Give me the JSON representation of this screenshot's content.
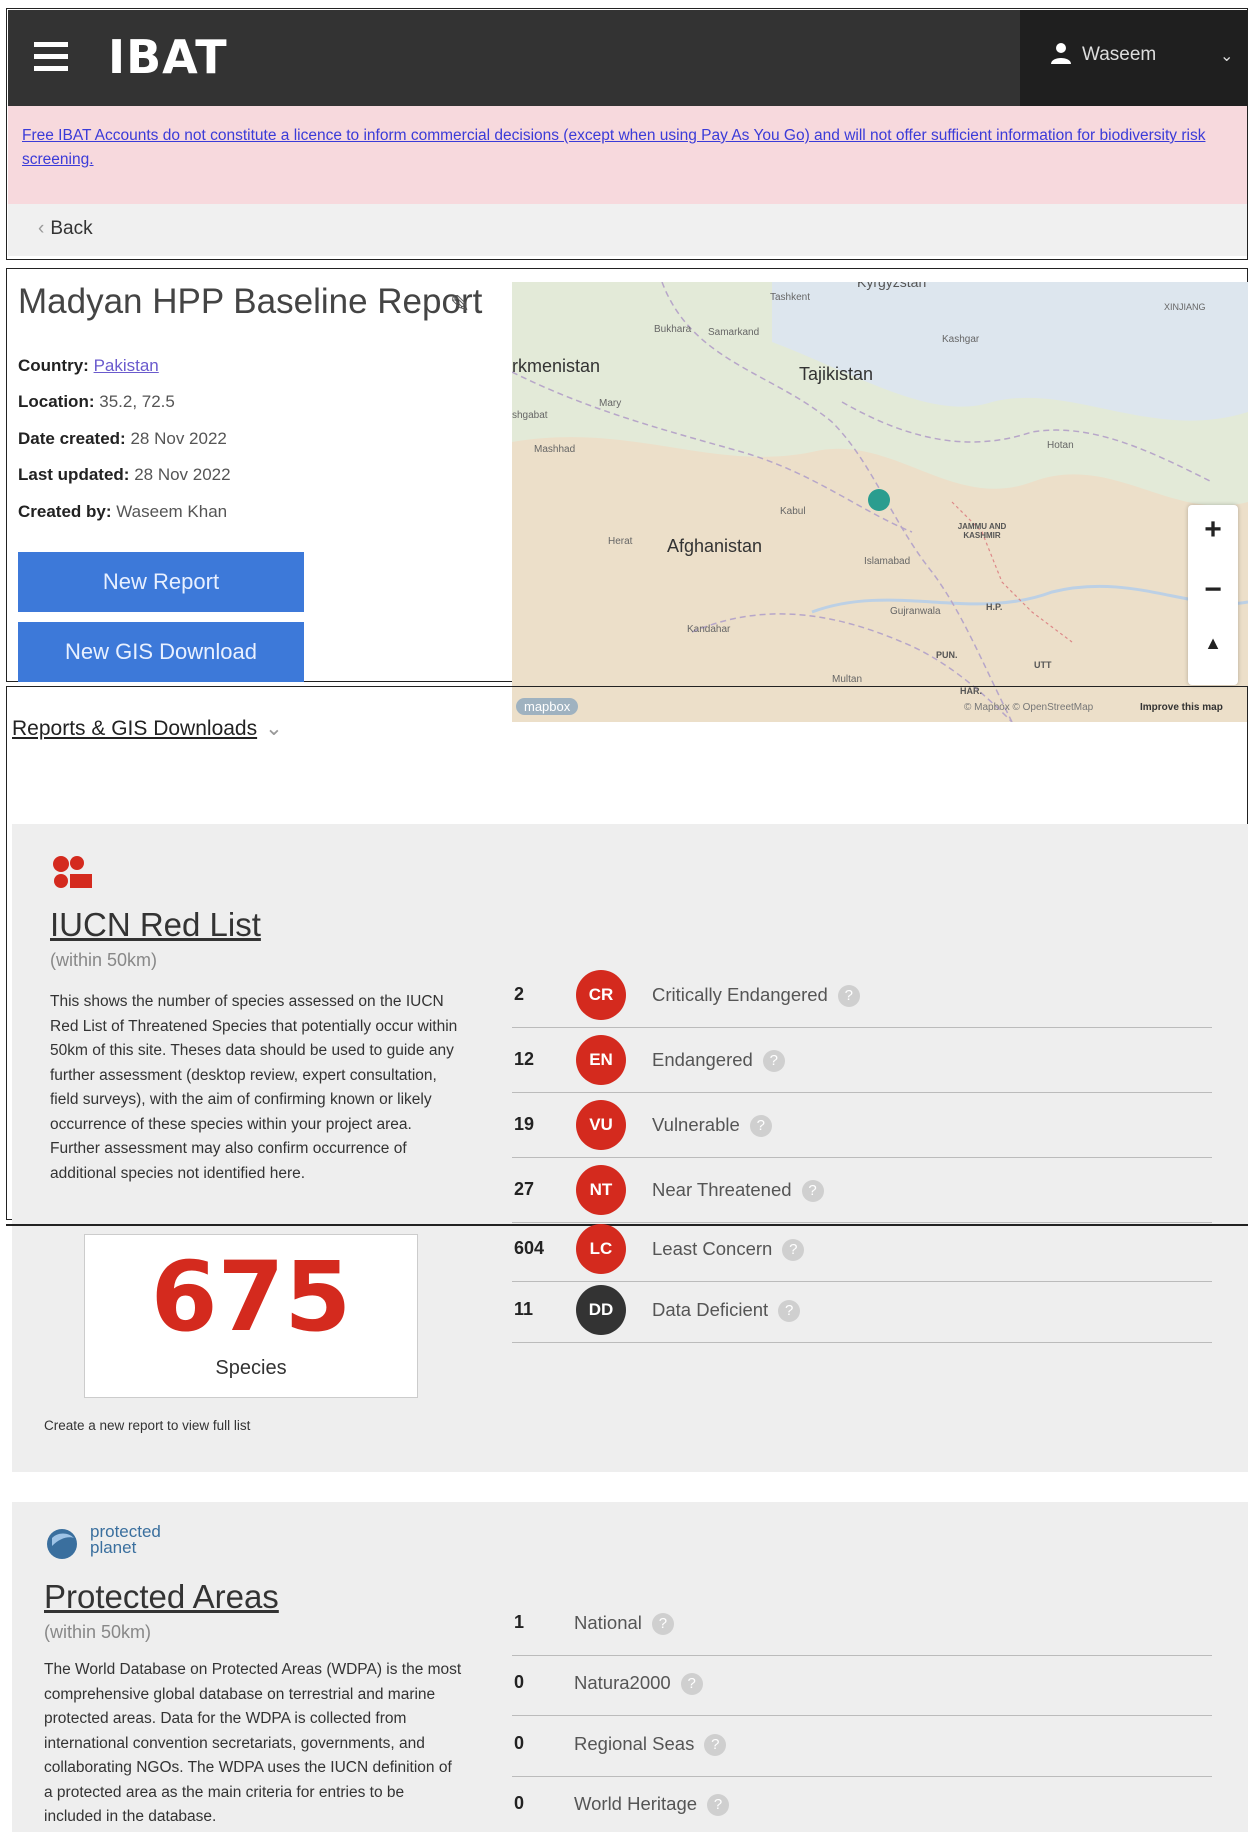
{
  "header": {
    "logo": "IBAT",
    "user_name": "Waseem"
  },
  "notice": {
    "text": "Free IBAT Accounts do not constitute a licence to inform commercial decisions (except when using Pay As You Go) and will not offer sufficient information for biodiversity risk screening."
  },
  "nav": {
    "back_label": "Back"
  },
  "report": {
    "title": "Madyan HPP Baseline Report",
    "country_label": "Country:",
    "country_value": "Pakistan",
    "location_label": "Location:",
    "location_value": "35.2, 72.5",
    "date_created_label": "Date created:",
    "date_created_value": "28 Nov 2022",
    "last_updated_label": "Last updated:",
    "last_updated_value": "28 Nov 2022",
    "created_by_label": "Created by:",
    "created_by_value": "Waseem Khan",
    "new_report_button": "New Report",
    "new_gis_button": "New GIS Download"
  },
  "map": {
    "labels": {
      "kyrgyzstan": "Kyrgyzstan",
      "xinjiang": "XINJIANG",
      "tashkent": "Tashkent",
      "bukhara": "Bukhara",
      "samarkand": "Samarkand",
      "kashgar": "Kashgar",
      "turkmenistan": "rkmenistan",
      "tajikistan": "Tajikistan",
      "ashgabat": "shgabat",
      "mary": "Mary",
      "mashhad": "Mashhad",
      "hotan": "Hotan",
      "kabul": "Kabul",
      "herat": "Herat",
      "afghanistan": "Afghanistan",
      "jammu": "JAMMU AND KASHMIR",
      "islamabad": "Islamabad",
      "gujranwala": "Gujranwala",
      "hp": "H.P.",
      "kandahar": "Kandahar",
      "pun": "PUN.",
      "utt": "UTT",
      "multan": "Multan",
      "har": "HAR."
    },
    "attribution_logo": "mapbox",
    "attribution": "© Mapbox © OpenStreetMap",
    "improve": "Improve this map",
    "marker_color": "#2a9d8f"
  },
  "reports_dropdown": {
    "label": "Reports & GIS Downloads"
  },
  "iucn": {
    "logo_text": "IUCN",
    "title": "IUCN Red List",
    "subtitle": "(within 50km)",
    "description": "This shows the number of species assessed on the IUCN Red List of Threatened Species that potentially occur within 50km of this site. Theses data should be used to guide any further assessment (desktop review, expert consultation, field surveys), with the aim of confirming known or likely occurrence of these species within your project area. Further assessment may also confirm occurrence of additional species not identified here.",
    "total": "675",
    "total_label": "Species",
    "footnote": "Create a new report to view full list",
    "rows": [
      {
        "count": "2",
        "code": "CR",
        "label": "Critically Endangered",
        "color": "#d42a1e"
      },
      {
        "count": "12",
        "code": "EN",
        "label": "Endangered",
        "color": "#d42a1e"
      },
      {
        "count": "19",
        "code": "VU",
        "label": "Vulnerable",
        "color": "#d42a1e"
      },
      {
        "count": "27",
        "code": "NT",
        "label": "Near Threatened",
        "color": "#d42a1e"
      },
      {
        "count": "604",
        "code": "LC",
        "label": "Least Concern",
        "color": "#d42a1e"
      },
      {
        "count": "11",
        "code": "DD",
        "label": "Data Deficient",
        "color": "#333333"
      }
    ]
  },
  "protected": {
    "logo_text_1": "protected",
    "logo_text_2": "planet",
    "title": "Protected Areas",
    "subtitle": "(within 50km)",
    "description": "The World Database on Protected Areas (WDPA) is the most comprehensive global database on terrestrial and marine protected areas. Data for the WDPA is collected from international convention secretariats, governments, and collaborating NGOs. The WDPA uses the IUCN definition of a protected area as the main criteria for entries to be included in the database.",
    "rows": [
      {
        "count": "1",
        "label": "National"
      },
      {
        "count": "0",
        "label": "Natura2000"
      },
      {
        "count": "0",
        "label": "Regional Seas"
      },
      {
        "count": "0",
        "label": "World Heritage"
      }
    ]
  }
}
